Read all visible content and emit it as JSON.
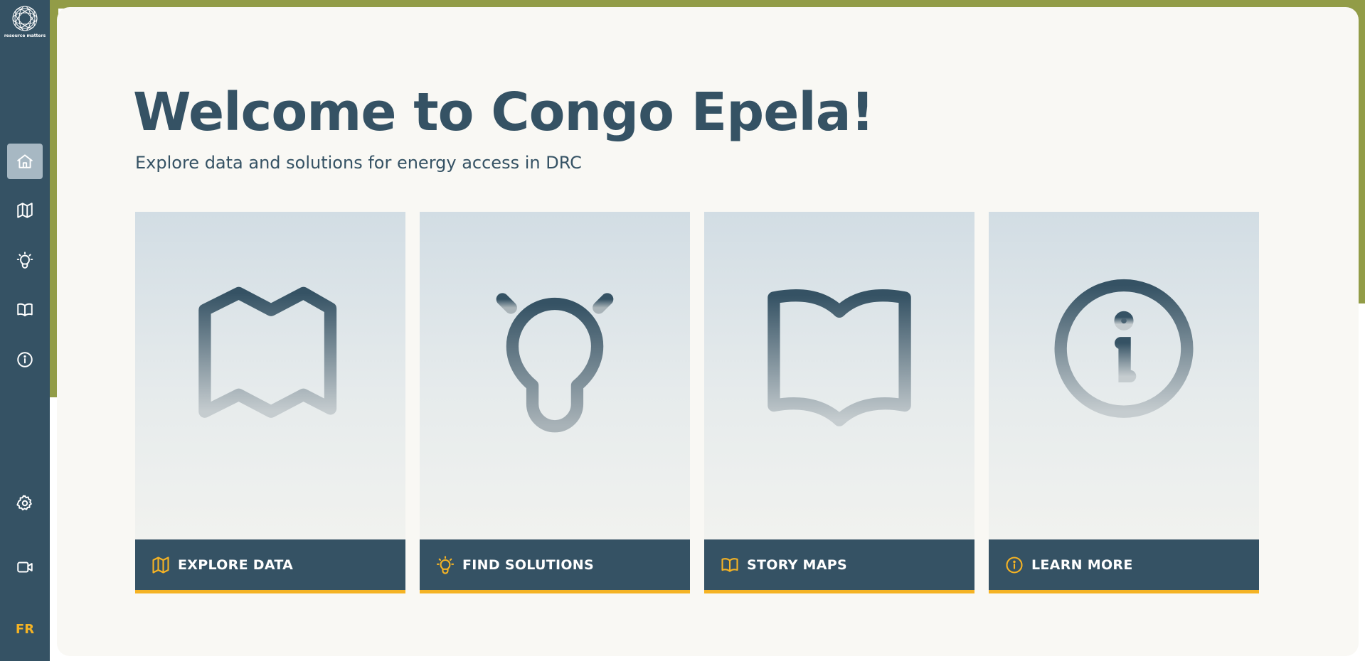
{
  "app": {
    "logo_text": "resource matters",
    "language_toggle": "FR"
  },
  "sidebar": {
    "items": [
      {
        "icon": "home-icon",
        "active": true
      },
      {
        "icon": "map-icon",
        "active": false
      },
      {
        "icon": "lightbulb-icon",
        "active": false
      },
      {
        "icon": "book-icon",
        "active": false
      },
      {
        "icon": "info-icon",
        "active": false
      },
      {
        "icon": "gear-icon",
        "active": false
      },
      {
        "icon": "video-icon",
        "active": false
      }
    ]
  },
  "hero": {
    "title": "Welcome to Congo Epela!",
    "subtitle": "Explore data and solutions for energy access in DRC"
  },
  "cards": [
    {
      "label": "EXPLORE DATA",
      "icon": "map-icon"
    },
    {
      "label": "FIND SOLUTIONS",
      "icon": "lightbulb-icon"
    },
    {
      "label": "STORY MAPS",
      "icon": "book-icon"
    },
    {
      "label": "LEARN MORE",
      "icon": "info-icon"
    }
  ],
  "colors": {
    "sidebar": "#355264",
    "accent": "#f5b324",
    "olive": "#929c47",
    "background": "#f9f8f4",
    "active_nav": "#a7b8c3"
  }
}
